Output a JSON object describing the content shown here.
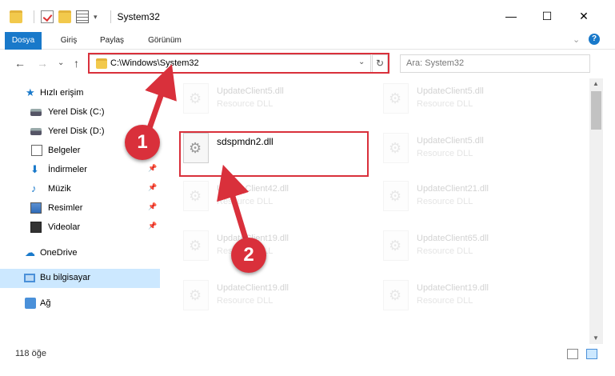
{
  "window": {
    "title": "System32",
    "minimize": "—",
    "maximize": "☐",
    "close": "✕"
  },
  "ribbon": {
    "tabs": [
      "Dosya",
      "Giriş",
      "Paylaş",
      "Görünüm"
    ],
    "active_tab": "Dosya",
    "help": "?"
  },
  "nav": {
    "back": "←",
    "forward": "→",
    "recent": "⌄",
    "up": "↑",
    "address": "C:\\Windows\\System32",
    "refresh": "↻",
    "search_placeholder": "Ara: System32"
  },
  "sidebar": {
    "items": [
      {
        "label": "Hızlı erişim",
        "icon": "star-icon"
      },
      {
        "label": "Yerel Disk (C:)",
        "icon": "disk-icon"
      },
      {
        "label": "Yerel Disk (D:)",
        "icon": "disk-icon"
      },
      {
        "label": "Belgeler",
        "icon": "documents-icon"
      },
      {
        "label": "İndirmeler",
        "icon": "downloads-icon",
        "pinned": true
      },
      {
        "label": "Müzik",
        "icon": "music-icon",
        "pinned": true
      },
      {
        "label": "Resimler",
        "icon": "pictures-icon",
        "pinned": true
      },
      {
        "label": "Videolar",
        "icon": "videos-icon",
        "pinned": true
      },
      {
        "label": "OneDrive",
        "icon": "onedrive-icon"
      },
      {
        "label": "Bu bilgisayar",
        "icon": "computer-icon",
        "selected": true
      },
      {
        "label": "Ağ",
        "icon": "network-icon"
      }
    ]
  },
  "files": [
    {
      "name": "UpdateClient5.dll",
      "desc": "Resource DLL"
    },
    {
      "name": "UpdateClient5.dll",
      "desc": "Resource DLL"
    },
    {
      "name": "sdspmdn2.dll",
      "desc": ""
    },
    {
      "name": "UpdateClient5.dll",
      "desc": "Resource DLL"
    },
    {
      "name": "UpdateClient42.dll",
      "desc": "Resource DLL"
    },
    {
      "name": "UpdateClient21.dll",
      "desc": "Resource DLL"
    },
    {
      "name": "UpdateClient19.dll",
      "desc": "Resource DLL"
    },
    {
      "name": "UpdateClient65.dll",
      "desc": "Resource DLL"
    },
    {
      "name": "UpdateClient19.dll",
      "desc": "Resource DLL"
    },
    {
      "name": "UpdateClient19.dll",
      "desc": "Resource DLL"
    }
  ],
  "status": {
    "count": "118 öğe"
  },
  "markers": [
    "1",
    "2"
  ],
  "colors": {
    "accent": "#1979ca",
    "highlight": "#d9303b",
    "selected": "#cce8ff"
  }
}
